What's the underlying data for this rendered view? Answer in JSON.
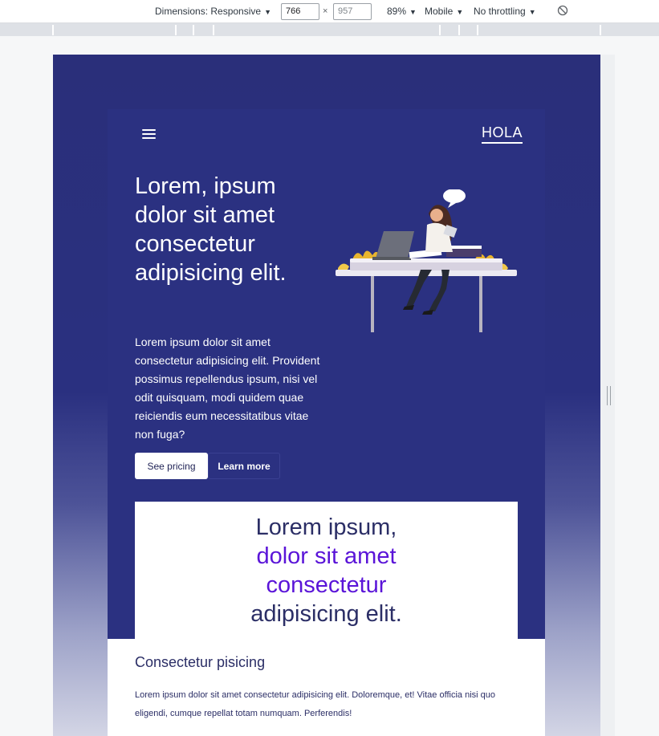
{
  "devtools": {
    "dimensions_label": "Dimensions: Responsive",
    "width_value": "766",
    "height_value": "957",
    "times": "×",
    "zoom": "89%",
    "device": "Mobile",
    "throttling": "No throttling",
    "caret": "▼",
    "icons": {
      "rotate": "rotate-icon",
      "resize": "resize-handle-icon"
    }
  },
  "site": {
    "brand": "HOLA",
    "menu_icon": "hamburger-menu-icon",
    "hero": {
      "title": "Lorem, ipsum dolor sit amet consectetur adipisicing elit.",
      "body": "Lorem ipsum dolor sit amet consectetur adipisicing elit. Provident possimus repellendus ipsum, nisi vel odit quisquam, modi quidem quae reiciendis eum necessitatibus vitae non fuga?",
      "primary_button": "See pricing",
      "secondary_button": "Learn more",
      "illustration": "woman-at-desk-illustration"
    },
    "quote": {
      "line1": "Lorem ipsum,",
      "line2": "dolor sit amet",
      "line3": "consectetur",
      "line4": "adipisicing elit."
    },
    "section": {
      "title": "Consectetur pisicing",
      "body": "Lorem ipsum dolor sit amet consectetur adipisicing elit. Doloremque, et! Vitae officia nisi quo eligendi, cumque repellat totam numquam. Perferendis!"
    },
    "colors": {
      "hero_bg": "#2b3181",
      "accent": "#5a14d8",
      "text_dark": "#2b2e66",
      "white": "#ffffff"
    }
  }
}
